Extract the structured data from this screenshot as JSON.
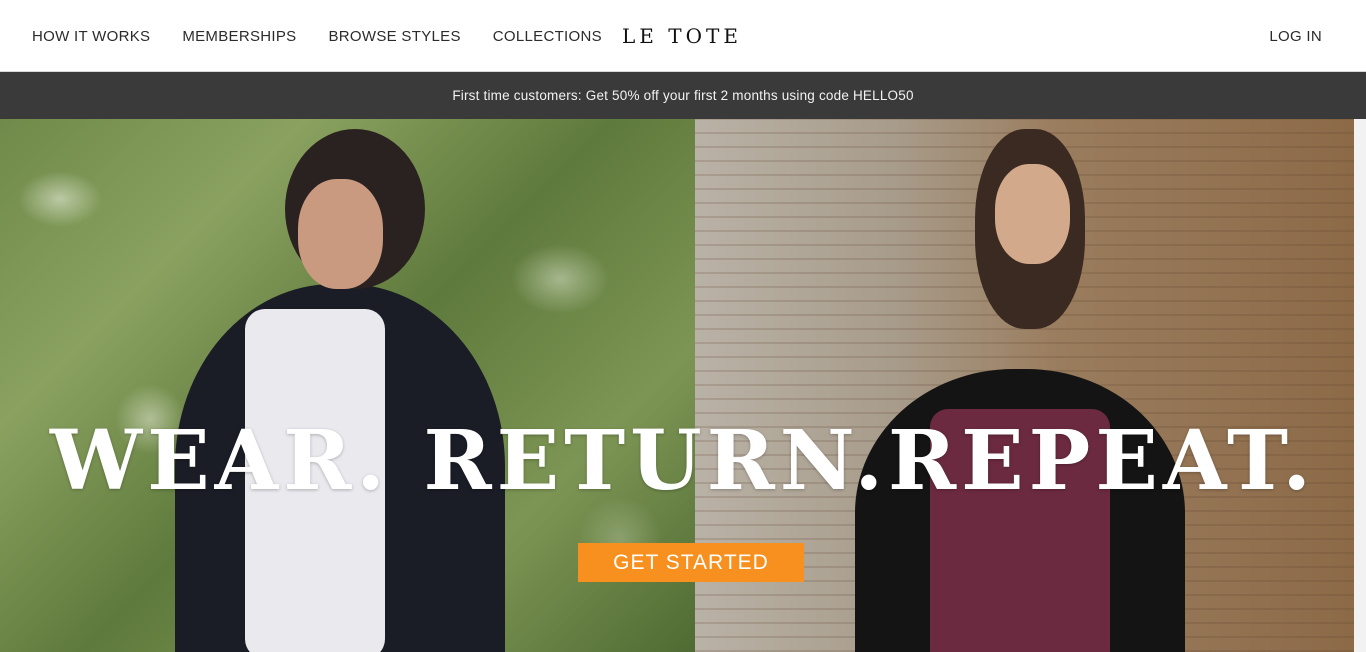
{
  "header": {
    "nav": [
      {
        "label": "HOW IT WORKS"
      },
      {
        "label": "MEMBERSHIPS"
      },
      {
        "label": "BROWSE STYLES"
      },
      {
        "label": "COLLECTIONS"
      }
    ],
    "logo": "LE TOTE",
    "login_label": "LOG IN"
  },
  "promo": {
    "text": "First time customers: Get 50% off your first 2 months using code HELLO50"
  },
  "hero": {
    "headline": "WEAR. RETURN.REPEAT.",
    "cta_label": "GET STARTED",
    "cta_color": "#f7901e"
  },
  "colors": {
    "promo_bg": "#3a3a3a",
    "header_bg": "#ffffff"
  }
}
